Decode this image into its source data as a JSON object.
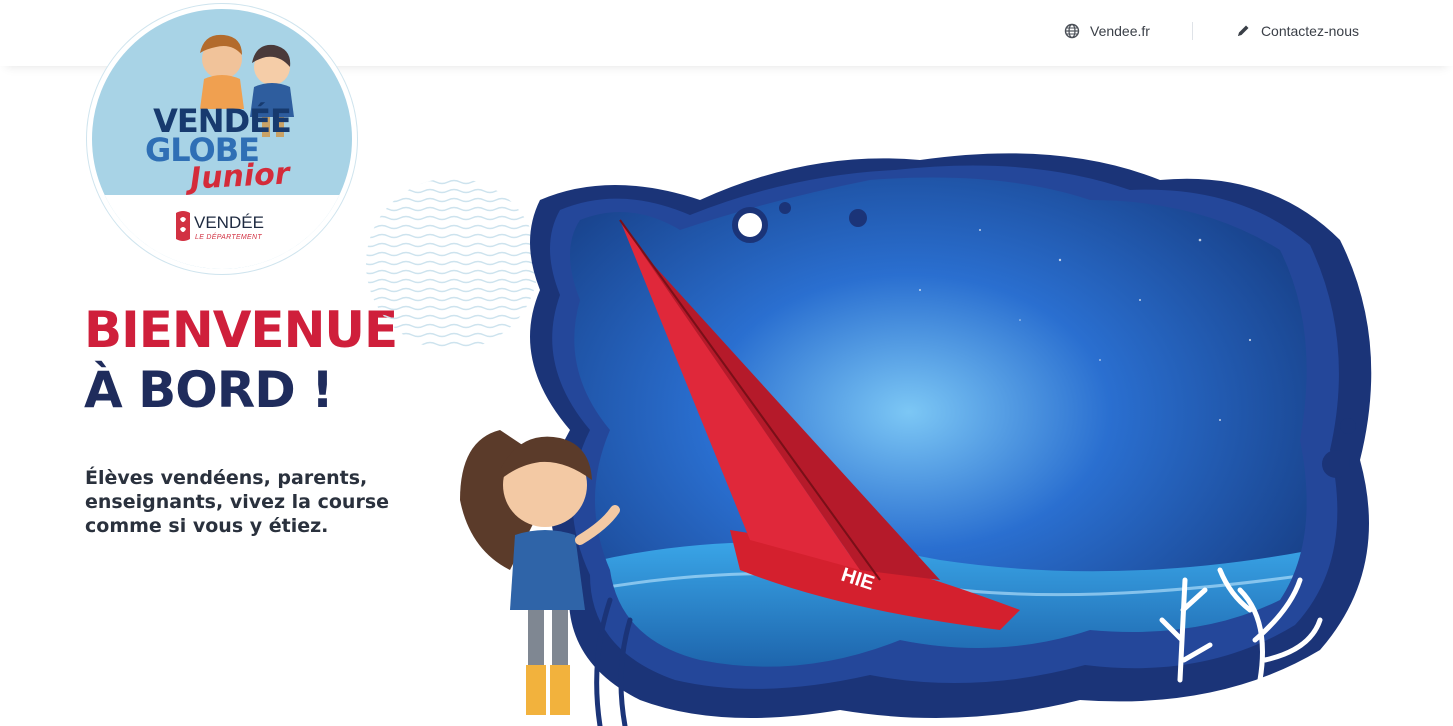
{
  "header": {
    "links": [
      {
        "label": "Vendee.fr",
        "icon": "globe-icon"
      },
      {
        "label": "Contactez-nous",
        "icon": "pencil-icon"
      }
    ]
  },
  "logo": {
    "line1": "VENDÉE",
    "line2": "GLOBE",
    "line3": "Junior",
    "department": "VENDÉE",
    "department_sub": "LE DÉPARTEMENT"
  },
  "hero": {
    "title_line1": "BIENVENUE",
    "title_line2": "À BORD !",
    "intro": "Élèves vendéens, parents, enseignants, vivez la course comme si vous y étiez.",
    "sail_text": "HIE"
  },
  "colors": {
    "red": "#cf1f3b",
    "navy": "#1f2c5c",
    "ocean": "#1d3f8f",
    "sky": "#a8d3e6"
  }
}
